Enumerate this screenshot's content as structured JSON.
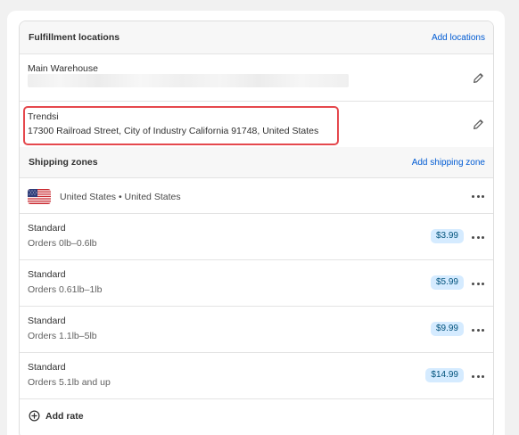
{
  "fulfillment": {
    "title": "Fulfillment locations",
    "add_link": "Add locations",
    "locations": [
      {
        "name": "Main Warehouse",
        "address": ""
      },
      {
        "name": "Trendsi",
        "address": "17300 Railroad Street, City of Industry California 91748, United States"
      }
    ]
  },
  "shipping": {
    "title": "Shipping zones",
    "add_link": "Add shipping zone",
    "zone": {
      "label": "United States • United States",
      "flag_icon": "us-flag-icon"
    },
    "rates": [
      {
        "name": "Standard",
        "condition": "Orders 0lb–0.6lb",
        "price": "$3.99"
      },
      {
        "name": "Standard",
        "condition": "Orders 0.61lb–1lb",
        "price": "$5.99"
      },
      {
        "name": "Standard",
        "condition": "Orders 1.1lb–5lb",
        "price": "$9.99"
      },
      {
        "name": "Standard",
        "condition": "Orders 5.1lb and up",
        "price": "$14.99"
      }
    ],
    "add_rate": "Add rate"
  },
  "colors": {
    "link": "#005bd3",
    "highlight": "#e5484d",
    "price_badge_bg": "#d5ebff",
    "price_badge_text": "#00527c"
  }
}
